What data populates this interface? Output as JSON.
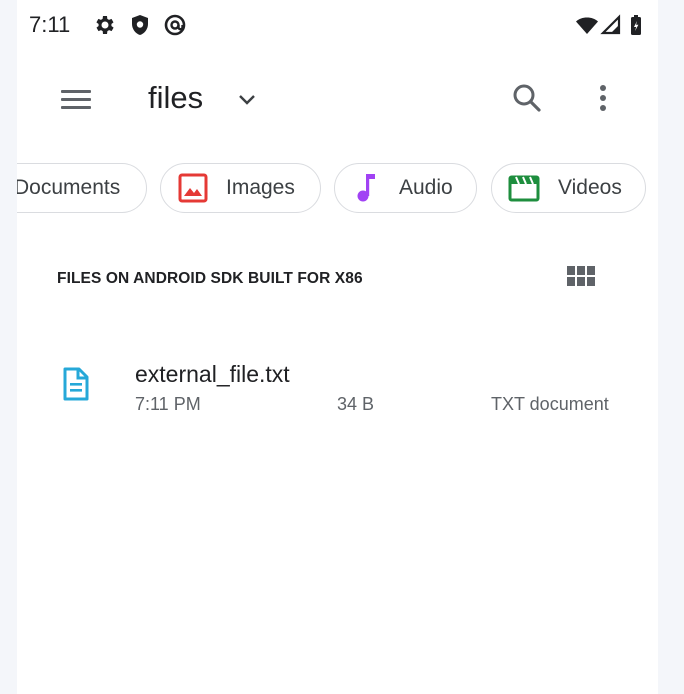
{
  "status_bar": {
    "time": "7:11",
    "icons": [
      "settings-icon",
      "shield-icon",
      "at-sign-icon",
      "wifi-icon",
      "signal-icon",
      "battery-icon"
    ]
  },
  "app_bar": {
    "title": "files",
    "menu_icon": "hamburger-menu-icon",
    "dropdown_icon": "chevron-down-icon",
    "search_icon": "search-icon",
    "more_icon": "more-vert-icon"
  },
  "chips": [
    {
      "label": "Documents",
      "icon": "document-icon"
    },
    {
      "label": "Images",
      "icon": "image-icon",
      "color": "#e53935"
    },
    {
      "label": "Audio",
      "icon": "music-note-icon",
      "color": "#a142f4"
    },
    {
      "label": "Videos",
      "icon": "video-clapper-icon",
      "color": "#1e8e3e"
    }
  ],
  "section": {
    "title": "FILES ON ANDROID SDK BUILT FOR X86",
    "view_toggle_icon": "grid-view-icon"
  },
  "files": [
    {
      "name": "external_file.txt",
      "time": "7:11 PM",
      "size": "34 B",
      "type": "TXT document",
      "icon": "text-document-icon",
      "icon_color": "#26a8d8"
    }
  ]
}
